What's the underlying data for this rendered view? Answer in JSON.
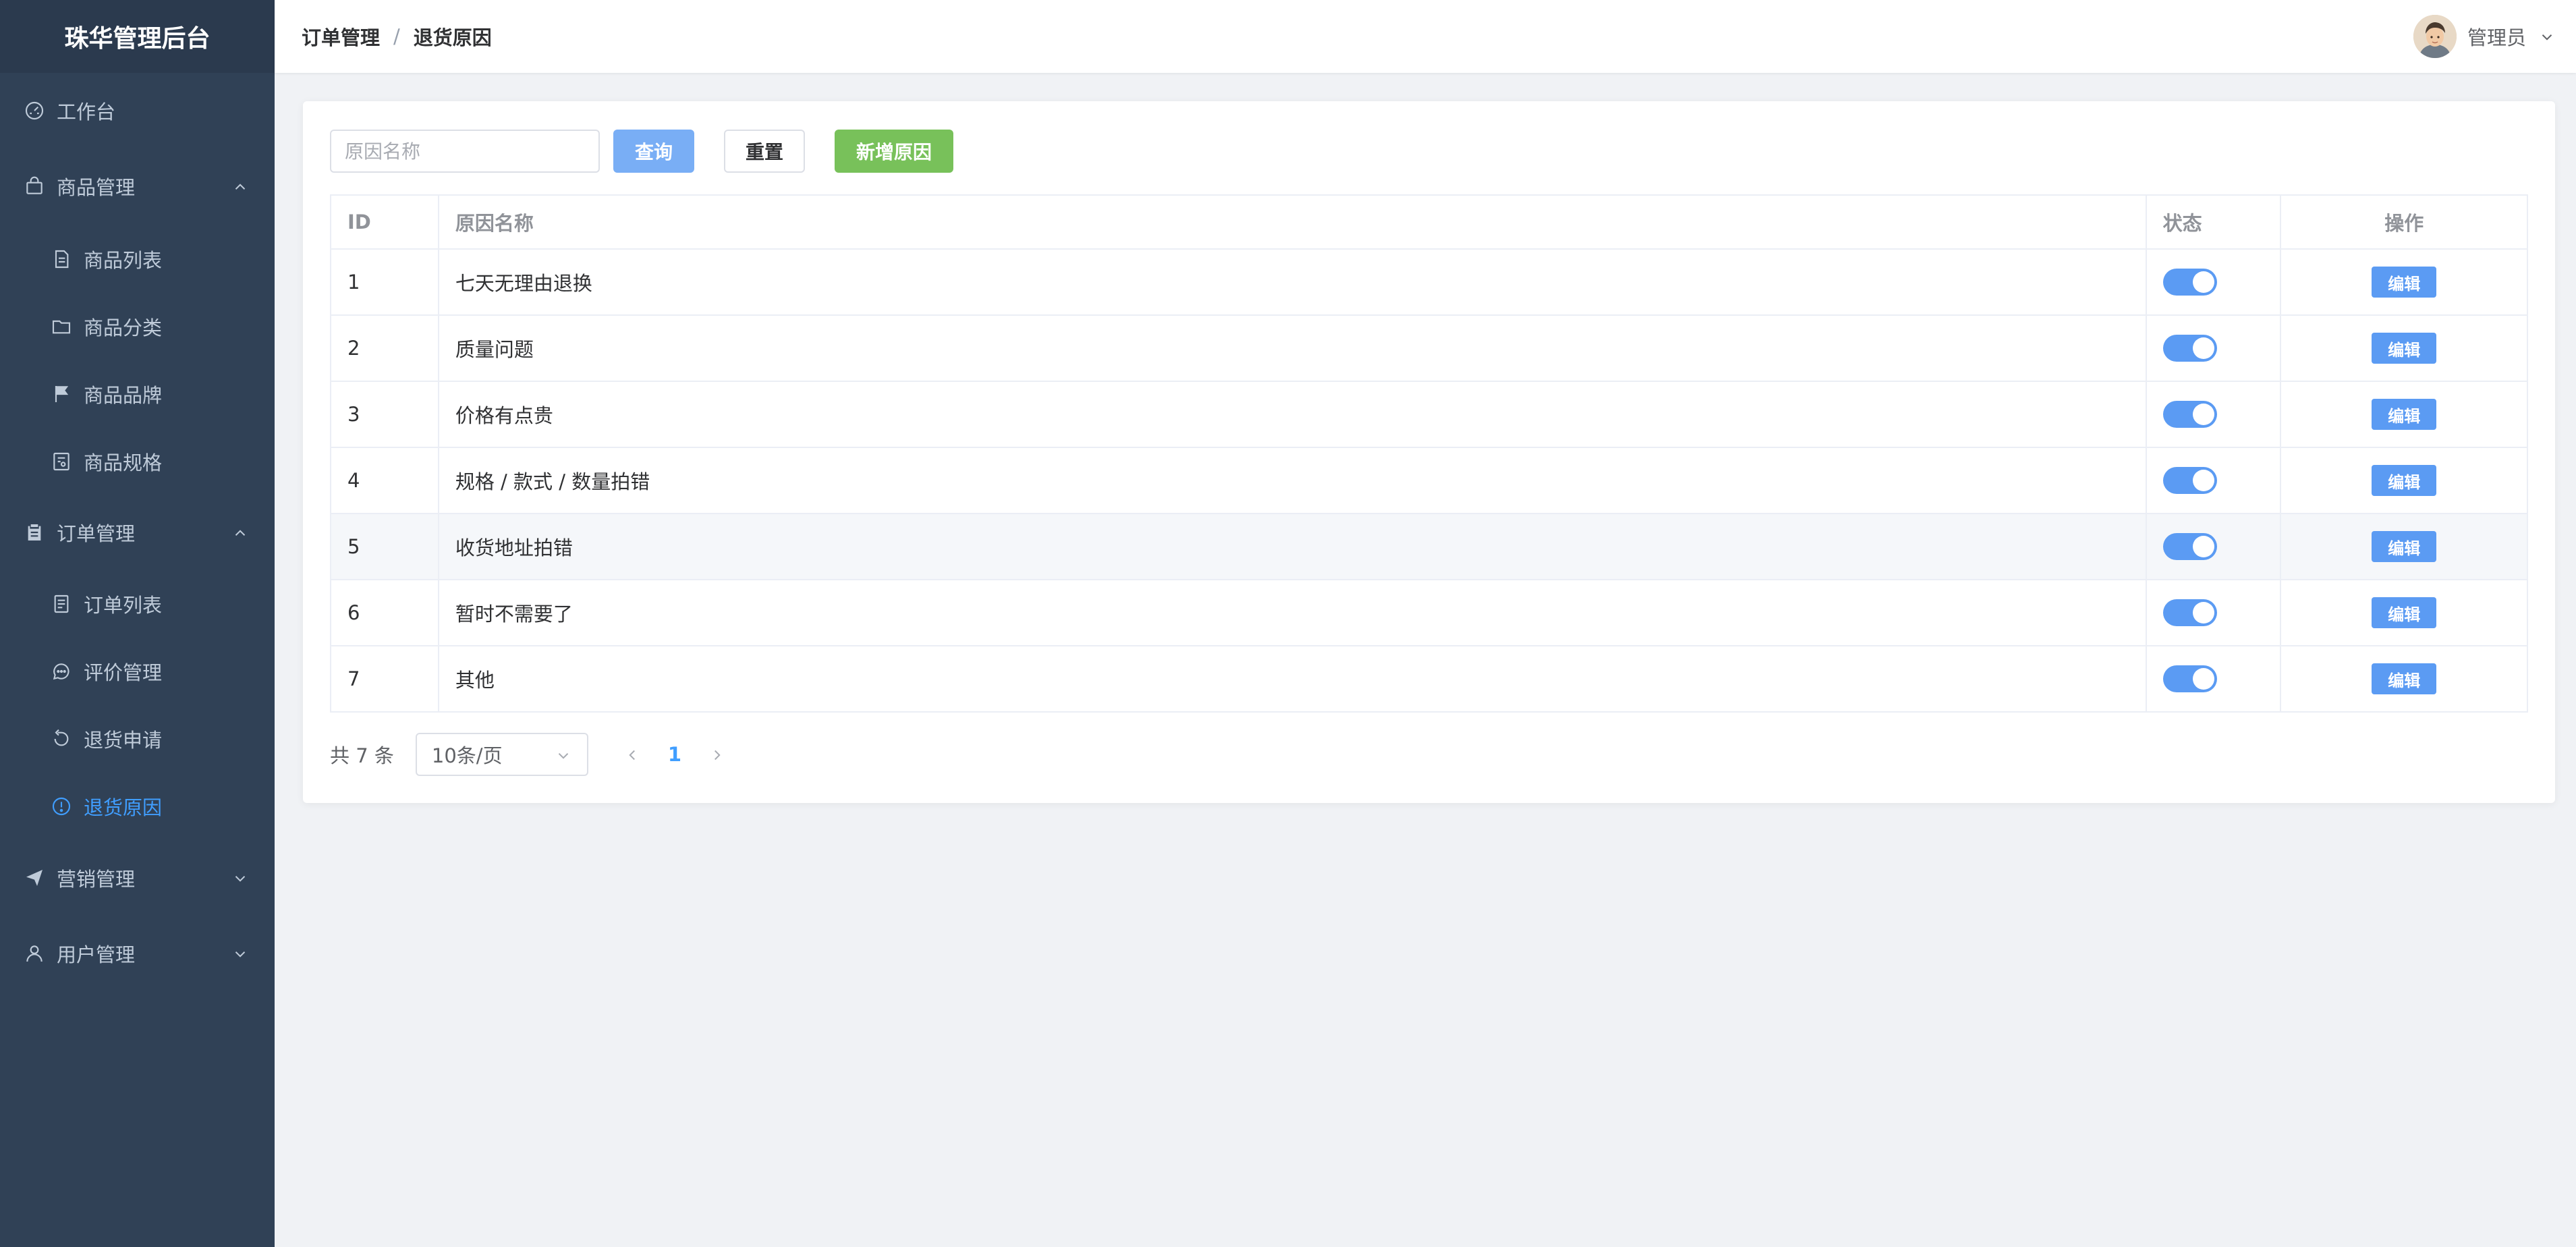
{
  "app": {
    "title": "珠华管理后台"
  },
  "sidebar": {
    "items": [
      {
        "label": "工作台",
        "icon": "dashboard-icon"
      },
      {
        "label": "商品管理",
        "icon": "bag-icon",
        "expanded": true
      },
      {
        "label": "商品列表",
        "icon": "document-icon"
      },
      {
        "label": "商品分类",
        "icon": "folder-icon"
      },
      {
        "label": "商品品牌",
        "icon": "flag-icon"
      },
      {
        "label": "商品规格",
        "icon": "tickets-icon"
      },
      {
        "label": "订单管理",
        "icon": "clipboard-icon",
        "expanded": true
      },
      {
        "label": "订单列表",
        "icon": "list-icon"
      },
      {
        "label": "评价管理",
        "icon": "chat-icon"
      },
      {
        "label": "退货申请",
        "icon": "refresh-icon"
      },
      {
        "label": "退货原因",
        "icon": "warning-icon",
        "active": true
      },
      {
        "label": "营销管理",
        "icon": "send-icon",
        "expanded": false
      },
      {
        "label": "用户管理",
        "icon": "user-icon",
        "expanded": false
      }
    ]
  },
  "header": {
    "breadcrumb": [
      "订单管理",
      "退货原因"
    ],
    "separator": "/",
    "user": "管理员"
  },
  "toolbar": {
    "search_placeholder": "原因名称",
    "query_label": "查询",
    "reset_label": "重置",
    "add_label": "新增原因"
  },
  "table": {
    "columns": [
      "ID",
      "原因名称",
      "状态",
      "操作"
    ],
    "rows": [
      {
        "id": "1",
        "name": "七天无理由退换",
        "status": true,
        "action": "编辑"
      },
      {
        "id": "2",
        "name": "质量问题",
        "status": true,
        "action": "编辑"
      },
      {
        "id": "3",
        "name": "价格有点贵",
        "status": true,
        "action": "编辑"
      },
      {
        "id": "4",
        "name": "规格 / 款式 / 数量拍错",
        "status": true,
        "action": "编辑"
      },
      {
        "id": "5",
        "name": "收货地址拍错",
        "status": true,
        "action": "编辑"
      },
      {
        "id": "6",
        "name": "暂时不需要了",
        "status": true,
        "action": "编辑"
      },
      {
        "id": "7",
        "name": "其他",
        "status": true,
        "action": "编辑"
      }
    ]
  },
  "pagination": {
    "total_text": "共 7 条",
    "page_size": "10条/页",
    "current_page": "1"
  },
  "colors": {
    "sidebar_bg": "#304156",
    "active": "#409eff",
    "primary": "#5b9bf3",
    "success": "#78c15a"
  }
}
